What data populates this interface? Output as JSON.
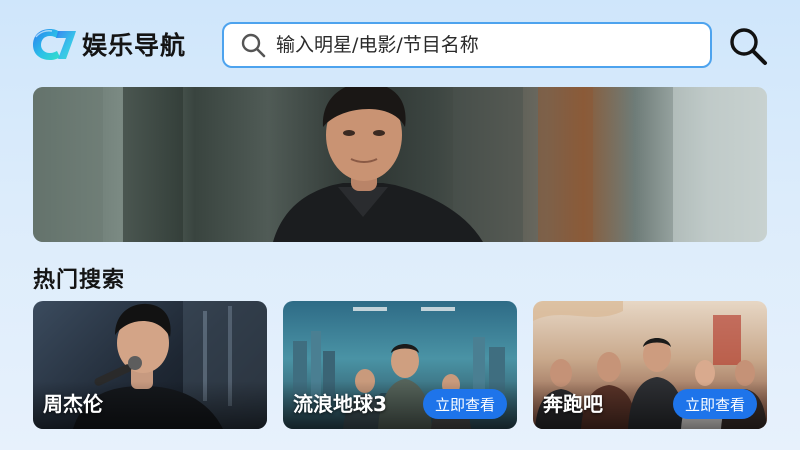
{
  "app": {
    "title": "娱乐导航",
    "logo_mark": "C7",
    "logo_icon": "c7-logo-icon"
  },
  "search": {
    "placeholder": "输入明星/电影/节目名称",
    "value": "",
    "input_icon": "search-icon",
    "button_icon": "search-icon"
  },
  "banner": {
    "image": "featured-celebrity-photo"
  },
  "hot": {
    "section_title": "热门搜索",
    "items": [
      {
        "title": "周杰伦",
        "image": "singer-on-stage-photo"
      },
      {
        "title": "流浪地球3",
        "button": "立即查看",
        "image": "movie-poster"
      },
      {
        "title": "奔跑吧",
        "button": "立即查看",
        "image": "variety-show-poster"
      }
    ]
  },
  "colors": {
    "accent": "#1e74ea",
    "search_border": "#4da3ee",
    "background_top": "#cfe6fb",
    "background_bottom": "#e7f1fc"
  }
}
